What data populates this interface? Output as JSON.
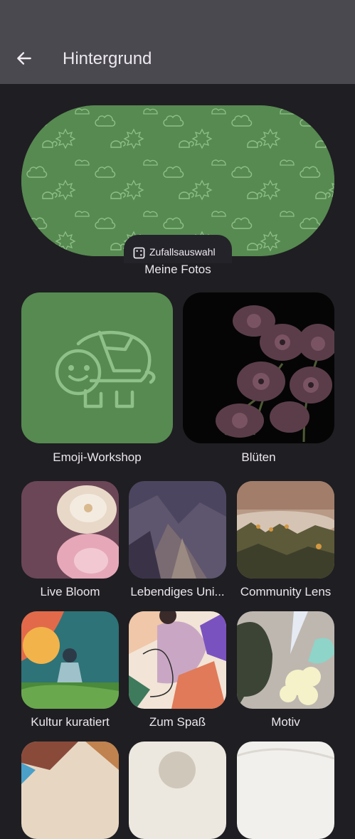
{
  "header": {
    "title": "Hintergrund"
  },
  "hero": {
    "chip_label": "Zufallsauswahl",
    "label": "Meine Fotos"
  },
  "categories": [
    {
      "label": "Emoji-Workshop"
    },
    {
      "label": "Blüten"
    },
    {
      "label": "Live Bloom"
    },
    {
      "label": "Lebendiges Uni..."
    },
    {
      "label": "Community Lens"
    },
    {
      "label": "Kultur kuratiert"
    },
    {
      "label": "Zum Spaß"
    },
    {
      "label": "Motiv"
    }
  ],
  "colors": {
    "accent_green": "#568a51",
    "background": "#1f1e22",
    "app_bar": "#4a4950"
  }
}
